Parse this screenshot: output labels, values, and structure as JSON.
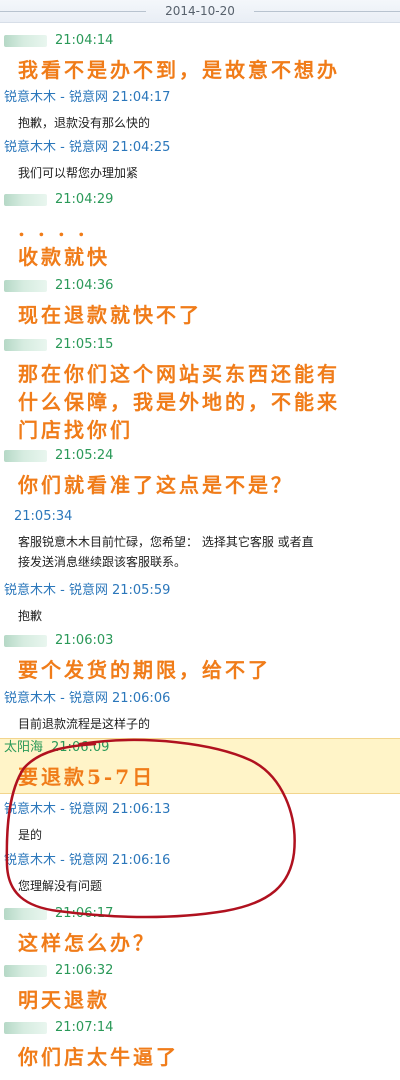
{
  "date_header": "2014-10-20",
  "messages": [
    {
      "sender": "",
      "time": "21:04:14",
      "style": "green",
      "lines": [
        "我看不是办不到，是故意不想办"
      ],
      "type": "orange"
    },
    {
      "sender": "锐意木木 - 锐意网",
      "time": "21:04:17",
      "style": "blue",
      "lines": [
        "抱歉，退款没有那么快的"
      ],
      "type": "black"
    },
    {
      "sender": "锐意木木 - 锐意网",
      "time": "21:04:25",
      "style": "blue",
      "lines": [
        "我们可以帮您办理加紧"
      ],
      "type": "black"
    },
    {
      "sender": "",
      "time": "21:04:29",
      "style": "green",
      "lines": [
        ". . . .",
        "收款就快"
      ],
      "type": "orange"
    },
    {
      "sender": "",
      "time": "21:04:36",
      "style": "green",
      "lines": [
        "现在退款就快不了"
      ],
      "type": "orange"
    },
    {
      "sender": "",
      "time": "21:05:15",
      "style": "green",
      "lines": [
        "那在你们这个网站买东西还能有",
        "什么保障，我是外地的，不能来",
        "门店找你们"
      ],
      "type": "orange"
    },
    {
      "sender": "",
      "time": "21:05:24",
      "style": "green",
      "lines": [
        "你们就看准了这点是不是？"
      ],
      "type": "orange"
    },
    {
      "sender": "",
      "time": "21:05:34",
      "style": "blue",
      "lines": [
        "客服锐意木木目前忙碌，您希望： 选择其它客服  或者直",
        "接发送消息继续跟该客服联系。"
      ],
      "type": "black"
    },
    {
      "sender": "锐意木木 - 锐意网",
      "time": "21:05:59",
      "style": "blue",
      "lines": [
        "抱歉"
      ],
      "type": "black"
    },
    {
      "sender": "",
      "time": "21:06:03",
      "style": "green",
      "lines": [
        "要个发货的期限，给不了"
      ],
      "type": "orange"
    },
    {
      "sender": "锐意木木 - 锐意网",
      "time": "21:06:06",
      "style": "blue",
      "lines": [
        "目前退款流程是这样子的"
      ],
      "type": "black"
    },
    {
      "sender": "太阳海",
      "time": "21:06:09",
      "style": "green",
      "lines": [
        "要退款5-7日"
      ],
      "type": "orange",
      "highlight": true
    },
    {
      "sender": "锐意木木 - 锐意网",
      "time": "21:06:13",
      "style": "blue",
      "lines": [
        "是的"
      ],
      "type": "black"
    },
    {
      "sender": "锐意木木 - 锐意网",
      "time": "21:06:16",
      "style": "blue",
      "lines": [
        "您理解没有问题"
      ],
      "type": "black"
    },
    {
      "sender": "",
      "time": "21:06:17",
      "style": "green",
      "lines": [
        "这样怎么办？"
      ],
      "type": "orange"
    },
    {
      "sender": "",
      "time": "21:06:32",
      "style": "green",
      "lines": [
        "明天退款"
      ],
      "type": "orange"
    },
    {
      "sender": "",
      "time": "21:07:14",
      "style": "green",
      "lines": [
        "你们店太牛逼了"
      ],
      "type": "orange"
    }
  ],
  "colors": {
    "green_time": "#2a9958",
    "blue_time": "#2b77bb",
    "orange_message": "#f07c19",
    "highlight_bg": "#fff4c8",
    "annotation_red": "#b0111f"
  }
}
